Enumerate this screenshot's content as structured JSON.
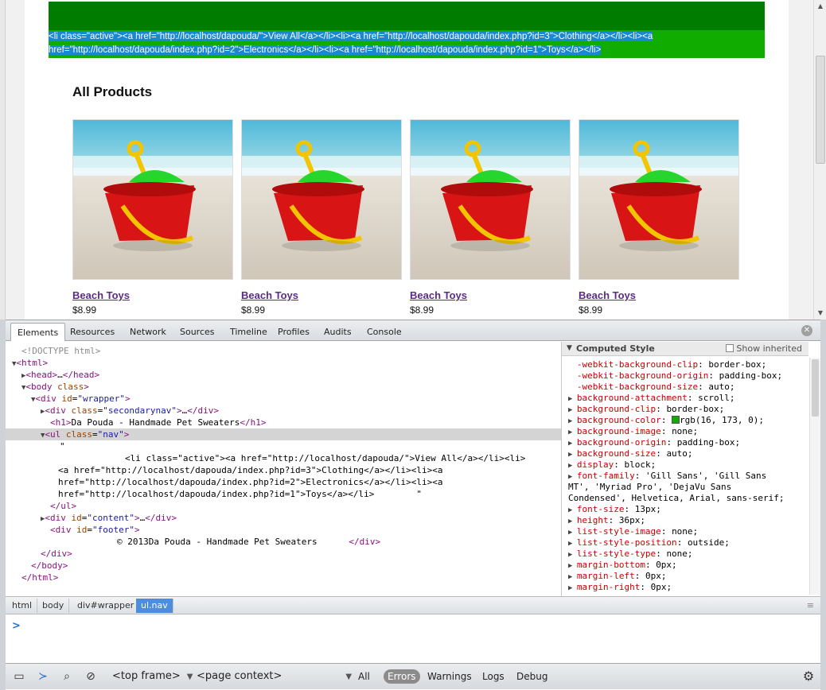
{
  "page": {
    "nav_raw": "<li class=\"active\"><a href=\"http://localhost/dapouda/\">View All</a></li><li><a href=\"http://localhost/dapouda/index.php?id=3\">Clothing</a></li><li><a href=\"http://localhost/dapouda/index.php?id=2\">Electronics</a></li><li><a href=\"http://localhost/dapouda/index.php?id=1\">Toys</a></li>",
    "title": "All Products",
    "products": [
      {
        "name": "Beach Toys",
        "price": "$8.99"
      },
      {
        "name": "Beach Toys",
        "price": "$8.99"
      },
      {
        "name": "Beach Toys",
        "price": "$8.99"
      },
      {
        "name": "Beach Toys",
        "price": "$8.99"
      }
    ],
    "colors": {
      "header": "#007c00",
      "nav": "#10ad00",
      "selection": "#1888d0"
    }
  },
  "devtools": {
    "tabs": [
      "Elements",
      "Resources",
      "Network",
      "Sources",
      "Timeline",
      "Profiles",
      "Audits",
      "Console"
    ],
    "active_tab": "Elements",
    "dom": {
      "doctype": "<!DOCTYPE html>",
      "html": "html",
      "head": "head",
      "body": "body",
      "body_attr": "class",
      "wrapper_id": "wrapper",
      "secondarynav": "secondarynav",
      "h1_text": "Da Pouda - Handmade Pet Sweaters",
      "ul_class": "nav",
      "text_quote": "\"",
      "text_line1": "<li class=\"active\"><a href=\"http://localhost/dapouda/\">View All</a></li><li>",
      "text_line2": "<a href=\"http://localhost/dapouda/index.php?id=3\">Clothing</a></li><li><a",
      "text_line3": "href=\"http://localhost/dapouda/index.php?id=2\">Electronics</a></li><li><a",
      "text_line4": "href=\"http://localhost/dapouda/index.php?id=1\">Toys</a></li>        \"",
      "content_id": "content",
      "footer_id": "footer",
      "footer_text": "© 2013Da Pouda - Handmade Pet Sweaters"
    },
    "computed": {
      "title": "Computed Style",
      "show_inherited": "Show inherited",
      "rows": [
        {
          "name": "-webkit-background-clip",
          "value": "border-box;"
        },
        {
          "name": "-webkit-background-origin",
          "value": "padding-box;"
        },
        {
          "name": "-webkit-background-size",
          "value": "auto;"
        },
        {
          "name": "background-attachment",
          "value": "scroll;"
        },
        {
          "name": "background-clip",
          "value": "border-box;"
        },
        {
          "name": "background-color",
          "value": "rgb(16, 173, 0);"
        },
        {
          "name": "background-image",
          "value": "none;"
        },
        {
          "name": "background-origin",
          "value": "padding-box;"
        },
        {
          "name": "background-size",
          "value": "auto;"
        },
        {
          "name": "display",
          "value": "block;"
        },
        {
          "name": "font-family",
          "value": "'Gill Sans', 'Gill Sans"
        },
        {
          "name": "",
          "value": "MT', 'Myriad Pro', 'DejaVu Sans"
        },
        {
          "name": "",
          "value": "Condensed', Helvetica, Arial, sans-serif;"
        },
        {
          "name": "font-size",
          "value": "13px;"
        },
        {
          "name": "height",
          "value": "36px;"
        },
        {
          "name": "list-style-image",
          "value": "none;"
        },
        {
          "name": "list-style-position",
          "value": "outside;"
        },
        {
          "name": "list-style-type",
          "value": "none;"
        },
        {
          "name": "margin-bottom",
          "value": "0px;"
        },
        {
          "name": "margin-left",
          "value": "0px;"
        },
        {
          "name": "margin-right",
          "value": "0px;"
        }
      ]
    },
    "breadcrumbs": [
      "html",
      "body",
      "div#wrapper",
      "ul.nav"
    ],
    "console_prompt": ">",
    "statusbar": {
      "frame": "<top frame>",
      "context": "<page context>",
      "filters": [
        "All",
        "Errors",
        "Warnings",
        "Logs",
        "Debug"
      ],
      "active_filter": "Errors"
    }
  }
}
